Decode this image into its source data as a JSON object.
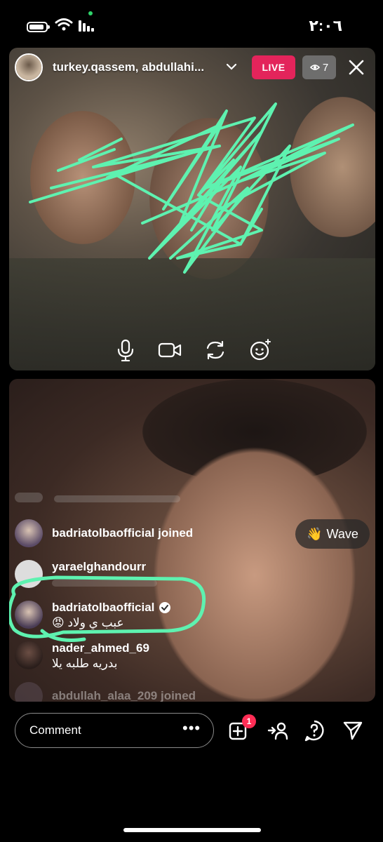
{
  "status": {
    "time": "٢:٠٦"
  },
  "live": {
    "host_names": "turkey.qassem, abdullahi...",
    "badge": "LIVE",
    "viewer_count": "7"
  },
  "comments": [
    {
      "user": "badriatolbaofficial joined",
      "msg": ""
    },
    {
      "user": "yaraelghandourr",
      "msg": ""
    },
    {
      "user": "badriatolbaofficial",
      "msg": "عبب ي ولاد 😡"
    },
    {
      "user": "nader_ahmed_69",
      "msg": "بدريه طلبه يلا"
    },
    {
      "user": "abdullah_alaa_209 joined",
      "msg": ""
    }
  ],
  "wave": {
    "label": "Wave",
    "emoji": "👋"
  },
  "bottom_bar": {
    "comment_placeholder": "Comment",
    "more": "•••",
    "notification_count": "1"
  },
  "colors": {
    "live": "#e3245b",
    "annotation": "#5ef2b0",
    "notif": "#ff2d55"
  }
}
